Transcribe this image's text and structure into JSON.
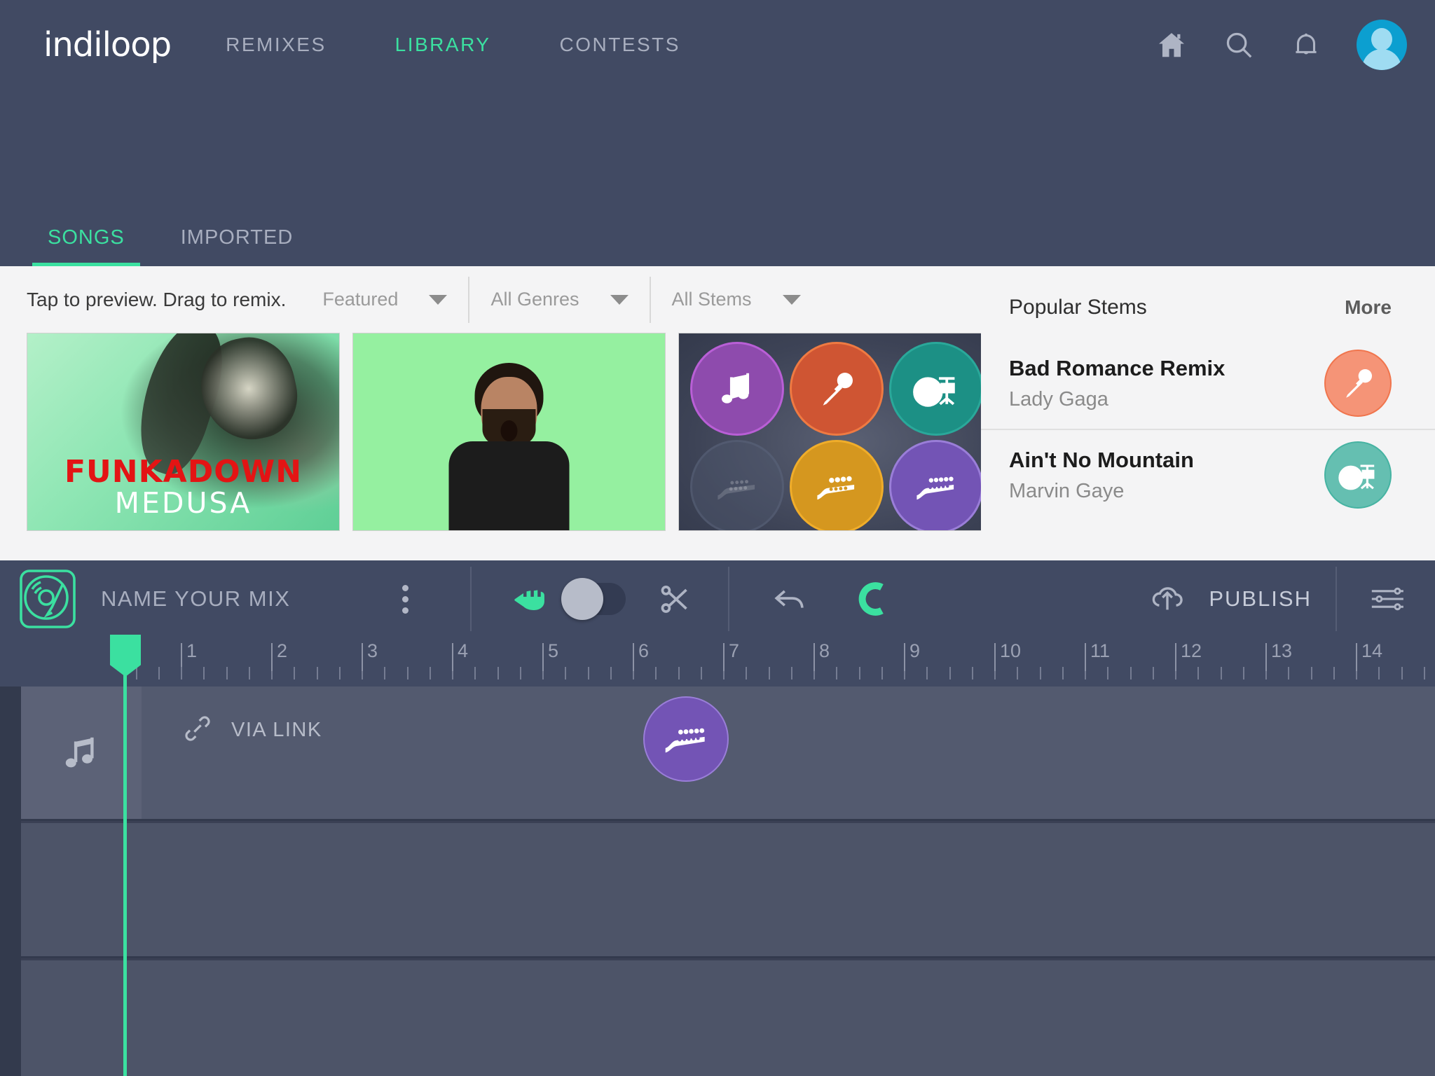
{
  "brand": {
    "name": "indiloop",
    "accent": "#3be0a0",
    "nav_bg": "#414a63"
  },
  "topnav": {
    "items": [
      {
        "label": "REMIXES",
        "active": false
      },
      {
        "label": "LIBRARY",
        "active": true
      },
      {
        "label": "CONTESTS",
        "active": false
      }
    ],
    "icons": [
      "home-icon",
      "search-icon",
      "notifications-bell-icon",
      "avatar"
    ]
  },
  "library": {
    "tabs": [
      {
        "label": "SONGS",
        "active": true
      },
      {
        "label": "IMPORTED",
        "active": false
      }
    ],
    "hint": "Tap to preview. Drag to remix.",
    "filters": [
      {
        "name": "sort",
        "value": "Featured"
      },
      {
        "name": "genre",
        "value": "All Genres"
      },
      {
        "name": "stems",
        "value": "All Stems"
      }
    ],
    "cards": [
      {
        "id": "funkadown",
        "title": "FUNKADOWN",
        "subtitle": "MEDUSA",
        "title_color": "#e31414",
        "subtitle_color": "#ffffff"
      },
      {
        "id": "green-screen",
        "title": "",
        "subtitle": ""
      },
      {
        "id": "stem-grid",
        "title": "",
        "subtitle": "",
        "stems": [
          {
            "kind": "music-note",
            "color": "#8e4bad",
            "state": "available"
          },
          {
            "kind": "microphone",
            "color": "#cf5533",
            "state": "available"
          },
          {
            "kind": "drums",
            "color": "#1c9085",
            "state": "available"
          },
          {
            "kind": "guitar",
            "color": "#50586e",
            "state": "dimmed"
          },
          {
            "kind": "guitar",
            "color": "#d5971f",
            "state": "available"
          },
          {
            "kind": "guitar",
            "color": "#7354b5",
            "state": "available"
          }
        ]
      }
    ]
  },
  "popular_stems": {
    "title": "Popular Stems",
    "more_label": "More",
    "items": [
      {
        "name": "Bad Romance Remix",
        "artist": "Lady Gaga",
        "icon": "microphone-icon",
        "icon_color": "#f59477"
      },
      {
        "name": "Ain't No Mountain",
        "artist": "Marvin Gaye",
        "icon": "drums-icon",
        "icon_color": "#65bfb1"
      }
    ]
  },
  "mixbar": {
    "logo_icon": "turntable-icon",
    "mix_name_placeholder": "NAME YOUR MIX",
    "overflow_icon": "more-vertical-icon",
    "tools": [
      {
        "name": "hand-tool",
        "icon": "hand-icon",
        "active": true
      },
      {
        "name": "hand-cut-toggle",
        "icon": "toggle-switch",
        "state": "off"
      },
      {
        "name": "cut-tool",
        "icon": "scissors-icon",
        "active": false
      },
      {
        "name": "undo",
        "icon": "undo-arrow-icon",
        "active": false
      },
      {
        "name": "magnet-snap",
        "icon": "magnet-icon",
        "active": true
      }
    ],
    "publish_label": "PUBLISH",
    "publish_icon": "cloud-upload-icon",
    "mixer_icon": "mixer-sliders-icon"
  },
  "timeline": {
    "bar_numbers": [
      1,
      2,
      3,
      4,
      5,
      6,
      7,
      8,
      9,
      10,
      11,
      12,
      13,
      14
    ],
    "subticks_per_bar": 4,
    "playhead_bar": 0,
    "playhead_color": "#3be0a0"
  },
  "tracks": [
    {
      "head_icon": "music-note-icon",
      "source_icon": "link-icon",
      "source_label": "VIA LINK",
      "clip": {
        "kind": "guitar",
        "color": "#7354b5"
      },
      "empty": false
    },
    {
      "head_icon": "",
      "source_icon": "",
      "source_label": "",
      "empty": true
    },
    {
      "head_icon": "",
      "source_icon": "",
      "source_label": "",
      "empty": true
    }
  ]
}
